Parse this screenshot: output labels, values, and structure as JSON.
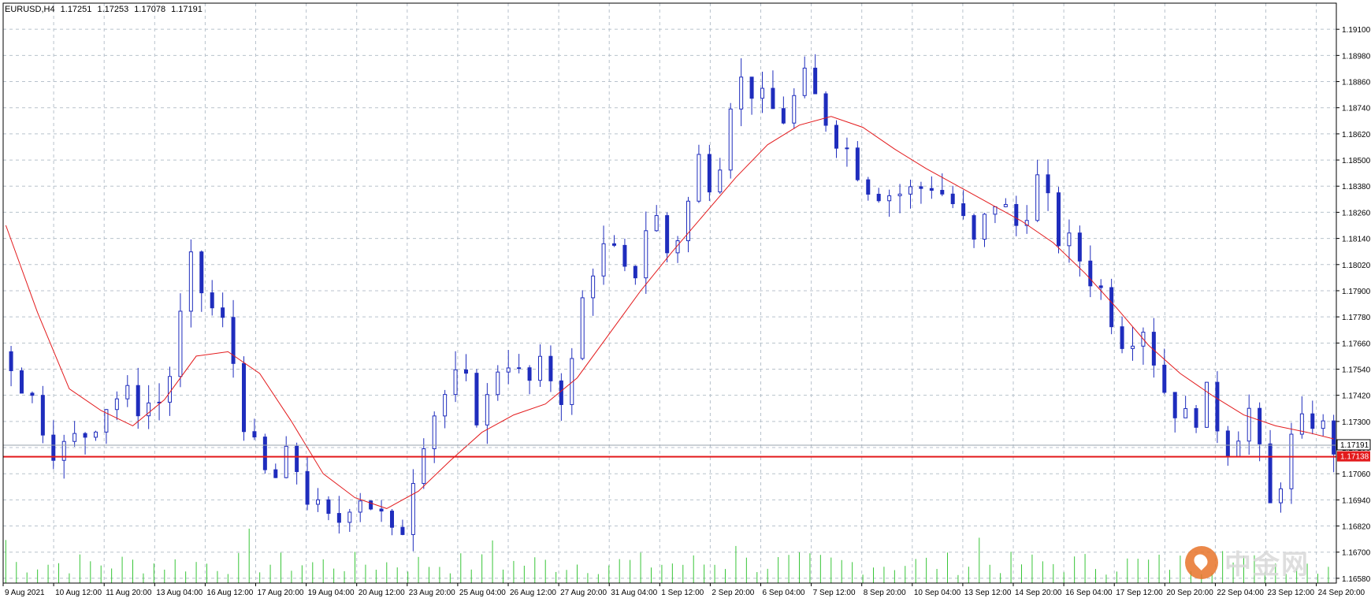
{
  "header": {
    "symbol_tf": "EURUSD,H4",
    "open": "1.17251",
    "high": "1.17253",
    "low": "1.17078",
    "close": "1.17191"
  },
  "watermark": {
    "text": "中金网"
  },
  "colors": {
    "background": "#ffffff",
    "grid": "#b8c2cc",
    "candle": "#1f2dbd",
    "ma_line": "#e31a1c",
    "volume": "#38c538",
    "bid_line": "#9aa3ad",
    "level_line": "#e31a1c",
    "axis_text": "#000000"
  },
  "chart_data": {
    "type": "candlestick",
    "symbol": "EURUSD",
    "timeframe": "H4",
    "ylim": [
      1.16558,
      1.1922
    ],
    "y_ticks": [
      "1.19100",
      "1.18980",
      "1.18860",
      "1.18740",
      "1.18620",
      "1.18500",
      "1.18380",
      "1.18260",
      "1.18140",
      "1.18020",
      "1.17900",
      "1.17780",
      "1.17660",
      "1.17540",
      "1.17420",
      "1.17300",
      "1.17180",
      "1.17060",
      "1.16940",
      "1.16820",
      "1.16700",
      "1.16580"
    ],
    "x_ticks": [
      "9 Aug 2021",
      "10 Aug 12:00",
      "11 Aug 20:00",
      "13 Aug 04:00",
      "16 Aug 12:00",
      "17 Aug 20:00",
      "19 Aug 04:00",
      "20 Aug 12:00",
      "23 Aug 20:00",
      "25 Aug 04:00",
      "26 Aug 12:00",
      "27 Aug 20:00",
      "31 Aug 04:00",
      "1 Sep 12:00",
      "2 Sep 20:00",
      "6 Sep 04:00",
      "7 Sep 12:00",
      "8 Sep 20:00",
      "10 Sep 04:00",
      "13 Sep 12:00",
      "14 Sep 20:00",
      "16 Sep 04:00",
      "17 Sep 12:00",
      "20 Sep 20:00",
      "22 Sep 04:00",
      "23 Sep 12:00",
      "24 Sep 20:00"
    ],
    "current_price": "1.17191",
    "level_price": "1.17138",
    "bars": 120,
    "close_path": [
      [
        0,
        1.1762
      ],
      [
        5,
        1.174
      ],
      [
        10,
        1.1715
      ],
      [
        15,
        1.1725
      ],
      [
        20,
        1.1742
      ],
      [
        26,
        1.1738
      ],
      [
        30,
        1.174
      ],
      [
        35,
        1.18
      ],
      [
        38,
        1.1785
      ],
      [
        42,
        1.177
      ],
      [
        46,
        1.172
      ],
      [
        50,
        1.17
      ],
      [
        54,
        1.1715
      ],
      [
        58,
        1.169
      ],
      [
        62,
        1.168
      ],
      [
        66,
        1.17
      ],
      [
        70,
        1.169
      ],
      [
        74,
        1.167
      ],
      [
        78,
        1.172
      ],
      [
        82,
        1.174
      ],
      [
        86,
        1.175
      ],
      [
        90,
        1.173
      ],
      [
        94,
        1.1765
      ],
      [
        98,
        1.1745
      ],
      [
        102,
        1.1755
      ],
      [
        106,
        1.174
      ],
      [
        110,
        1.18
      ],
      [
        114,
        1.181
      ],
      [
        118,
        1.179
      ],
      [
        122,
        1.183
      ],
      [
        125,
        1.1808
      ],
      [
        128,
        1.182
      ],
      [
        131,
        1.185
      ],
      [
        134,
        1.184
      ],
      [
        137,
        1.188
      ],
      [
        140,
        1.1888
      ],
      [
        143,
        1.1875
      ],
      [
        147,
        1.187
      ],
      [
        151,
        1.1885
      ],
      [
        155,
        1.187
      ],
      [
        159,
        1.1855
      ],
      [
        163,
        1.184
      ],
      [
        167,
        1.1835
      ],
      [
        171,
        1.1835
      ],
      [
        175,
        1.184
      ],
      [
        179,
        1.183
      ],
      [
        183,
        1.181
      ],
      [
        187,
        1.1832
      ],
      [
        191,
        1.182
      ],
      [
        195,
        1.184
      ],
      [
        199,
        1.1815
      ],
      [
        203,
        1.1805
      ],
      [
        207,
        1.179
      ],
      [
        211,
        1.177
      ],
      [
        215,
        1.1775
      ],
      [
        219,
        1.1745
      ],
      [
        223,
        1.173
      ],
      [
        227,
        1.174
      ],
      [
        231,
        1.172
      ],
      [
        235,
        1.1735
      ],
      [
        239,
        1.169
      ],
      [
        243,
        1.172
      ],
      [
        247,
        1.1732
      ],
      [
        251,
        1.1719
      ]
    ],
    "ma_path": [
      [
        0,
        1.182
      ],
      [
        6,
        1.178
      ],
      [
        12,
        1.1745
      ],
      [
        18,
        1.1735
      ],
      [
        24,
        1.1728
      ],
      [
        30,
        1.174
      ],
      [
        36,
        1.176
      ],
      [
        42,
        1.1762
      ],
      [
        48,
        1.1752
      ],
      [
        54,
        1.173
      ],
      [
        60,
        1.1706
      ],
      [
        66,
        1.1695
      ],
      [
        72,
        1.169
      ],
      [
        78,
        1.1698
      ],
      [
        84,
        1.1712
      ],
      [
        90,
        1.1725
      ],
      [
        96,
        1.1733
      ],
      [
        102,
        1.1738
      ],
      [
        108,
        1.175
      ],
      [
        114,
        1.177
      ],
      [
        120,
        1.179
      ],
      [
        126,
        1.1808
      ],
      [
        132,
        1.1825
      ],
      [
        138,
        1.1842
      ],
      [
        144,
        1.1857
      ],
      [
        150,
        1.1866
      ],
      [
        156,
        1.187
      ],
      [
        162,
        1.1865
      ],
      [
        168,
        1.1855
      ],
      [
        174,
        1.1846
      ],
      [
        180,
        1.1838
      ],
      [
        186,
        1.183
      ],
      [
        192,
        1.1822
      ],
      [
        198,
        1.1812
      ],
      [
        204,
        1.1798
      ],
      [
        210,
        1.1782
      ],
      [
        216,
        1.1765
      ],
      [
        222,
        1.1752
      ],
      [
        228,
        1.1742
      ],
      [
        234,
        1.1733
      ],
      [
        240,
        1.1728
      ],
      [
        246,
        1.1725
      ],
      [
        251,
        1.1722
      ]
    ],
    "volume_max": 1,
    "title": "",
    "xlabel": "",
    "ylabel": ""
  }
}
